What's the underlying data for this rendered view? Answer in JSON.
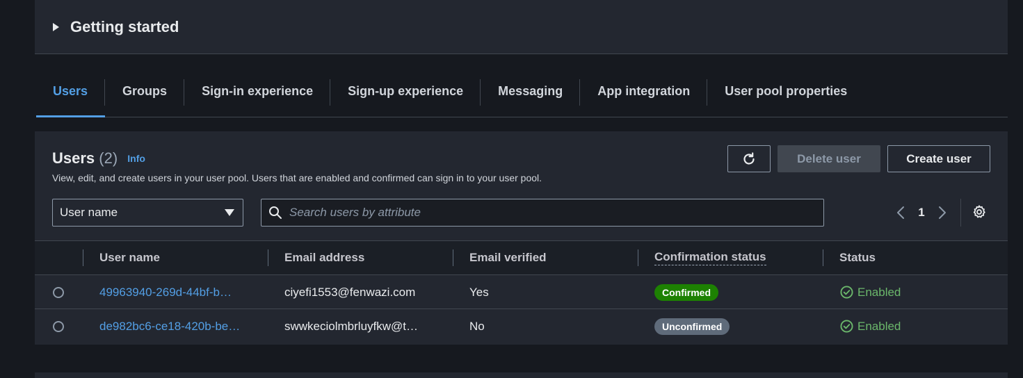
{
  "getting_started": {
    "title": "Getting started"
  },
  "tabs": [
    {
      "label": "Users",
      "active": true
    },
    {
      "label": "Groups"
    },
    {
      "label": "Sign-in experience"
    },
    {
      "label": "Sign-up experience"
    },
    {
      "label": "Messaging"
    },
    {
      "label": "App integration"
    },
    {
      "label": "User pool properties"
    }
  ],
  "users": {
    "title": "Users",
    "count": "(2)",
    "info": "Info",
    "description": "View, edit, and create users in your user pool. Users that are enabled and confirmed can sign in to your user pool.",
    "refresh_icon": "refresh-icon",
    "delete_label": "Delete user",
    "create_label": "Create user",
    "filter_select": "User name",
    "search_placeholder": "Search users by attribute",
    "page": "1",
    "columns": [
      "User name",
      "Email address",
      "Email verified",
      "Confirmation status",
      "Status"
    ],
    "rows": [
      {
        "username": "49963940-269d-44bf-b…",
        "email": "ciyefi1553@fenwazi.com",
        "verified": "Yes",
        "confirmation": "Confirmed",
        "status": "Enabled"
      },
      {
        "username": "de982bc6-ce18-420b-be…",
        "email": "swwkeciolmbrluyfkw@t…",
        "verified": "No",
        "confirmation": "Unconfirmed",
        "status": "Enabled"
      }
    ]
  },
  "colors": {
    "accent": "#539fe5",
    "confirmed": "#1d8102",
    "unconfirmed": "#5f6b7a",
    "enabled": "#6bb76b"
  }
}
